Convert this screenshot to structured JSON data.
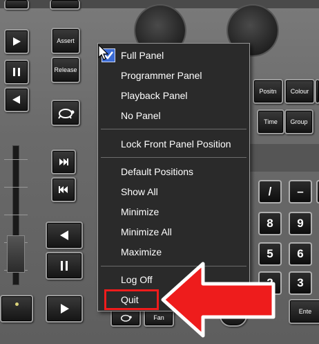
{
  "console": {
    "assert_label": "Assert",
    "release_label": "Release",
    "position_label": "Positn",
    "colour_label": "Colour",
    "time_label": "Time",
    "group_label": "Group",
    "enter_label": "Ente",
    "fan_label": "Fan",
    "keypad": [
      "/",
      "–",
      "8",
      "9",
      "5",
      "6",
      "2",
      "3"
    ]
  },
  "context_menu": {
    "items": [
      {
        "label": "Full Panel",
        "checked": true
      },
      {
        "label": "Programmer Panel"
      },
      {
        "label": "Playback Panel"
      },
      {
        "label": "No Panel"
      },
      {
        "label": "Lock Front Panel Position"
      },
      {
        "label": "Default Positions"
      },
      {
        "label": "Show All"
      },
      {
        "label": "Minimize"
      },
      {
        "label": "Minimize All"
      },
      {
        "label": "Maximize"
      },
      {
        "label": "Log Off"
      },
      {
        "label": "Quit",
        "highlighted": true
      }
    ]
  },
  "annotation": {
    "highlight_color": "#ee1c1c",
    "arrow_color": "#ee1c1c",
    "arrow_direction": "left"
  }
}
